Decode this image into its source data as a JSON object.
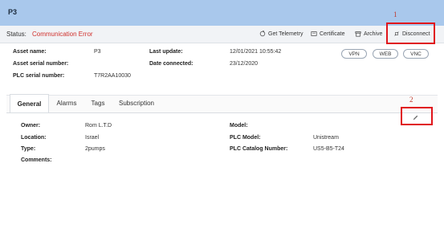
{
  "header": {
    "title": "P3"
  },
  "status": {
    "label": "Status:",
    "value": "Communication Error",
    "actions": {
      "telemetry": "Get Telemetry",
      "certificate": "Certificate",
      "archive": "Archive",
      "disconnect": "Disconnect"
    }
  },
  "info": {
    "asset_name_label": "Asset name:",
    "asset_name_value": "P3",
    "asset_serial_label": "Asset serial number:",
    "plc_serial_label": "PLC serial number:",
    "plc_serial_value": "T7R2AA10030",
    "last_update_label": "Last update:",
    "last_update_value": "12/01/2021 10:55:42",
    "date_connected_label": "Date connected:",
    "date_connected_value": "23/12/2020"
  },
  "remote": {
    "vpn": "VPN",
    "web": "WEB",
    "vnc": "VNC"
  },
  "tabs": [
    "General",
    "Alarms",
    "Tags",
    "Subscription"
  ],
  "general": {
    "owner_label": "Owner:",
    "owner_value": "Rom L.T.D",
    "location_label": "Location:",
    "location_value": "Israel",
    "type_label": "Type:",
    "type_value": "2pumps",
    "comments_label": "Comments:",
    "model_label": "Model:",
    "plc_model_label": "PLC Model:",
    "plc_model_value": "Unistream",
    "plc_catalog_label": "PLC Catalog Number:",
    "plc_catalog_value": "US5-B5-T24"
  },
  "annotations": {
    "one": "1",
    "two": "2"
  },
  "colors": {
    "header_bg": "#a9c8ec",
    "error": "#d0312d",
    "annotation": "#e0141b"
  }
}
